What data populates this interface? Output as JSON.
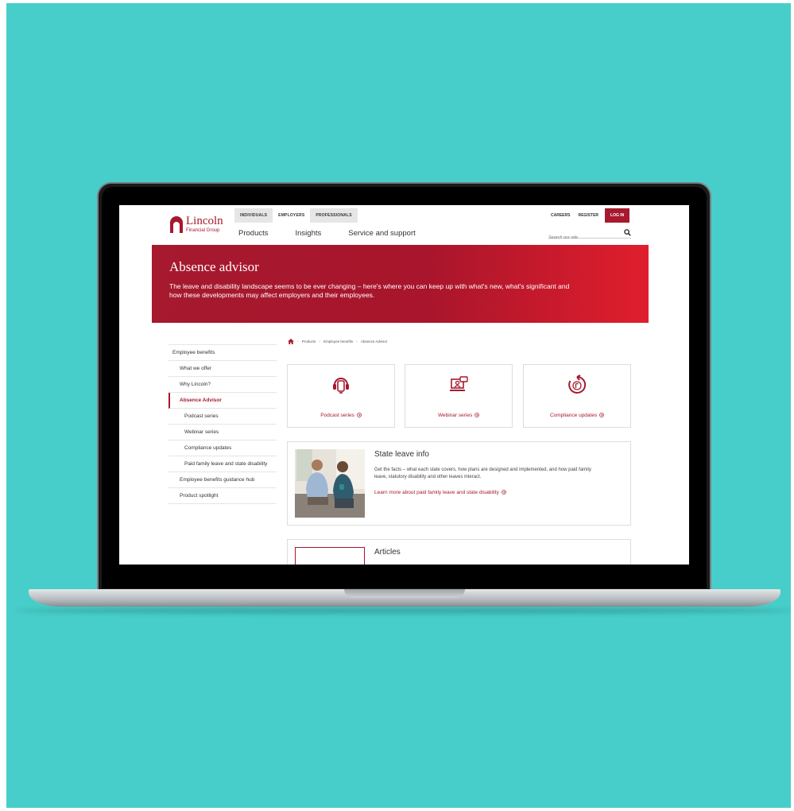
{
  "header": {
    "logo": {
      "word": "Lincoln",
      "sub": "Financial Group"
    },
    "audience_tabs": [
      "INDIVIDUALS",
      "EMPLOYERS",
      "PROFESSIONALS"
    ],
    "main_nav": {
      "products": "Products",
      "insights": "Insights",
      "service": "Service and support"
    },
    "utility": {
      "careers": "CAREERS",
      "register": "REGISTER",
      "login": "LOG IN"
    },
    "search": {
      "placeholder": "Search our site"
    }
  },
  "hero": {
    "title": "Absence advisor",
    "description": "The leave and disability landscape seems to be ever changing – here's where you can keep up with what's new, what's significant and how these developments may affect employers and their employees."
  },
  "breadcrumb": [
    "Products",
    "Employee benefits",
    "Absence Advisor"
  ],
  "sidebar": {
    "items": [
      "Employee benefits",
      "What we offer",
      "Why Lincoln?",
      "Absence Advisor",
      "Podcast series",
      "Webinar series",
      "Compliance updates",
      "Paid family leave and state disability",
      "Employee benefits guidance hub",
      "Product spotlight"
    ]
  },
  "cards": [
    {
      "label": "Podcast series",
      "icon": "podcast-icon"
    },
    {
      "label": "Webinar series",
      "icon": "webinar-icon"
    },
    {
      "label": "Compliance updates",
      "icon": "compliance-icon"
    }
  ],
  "state_leave": {
    "title": "State leave info",
    "description": "Get the facts – what each state covers, how plans are designed and implemented, and how paid family leave, statutory disability and other leaves interact.",
    "link": "Learn more about paid family leave and state disability"
  },
  "articles": {
    "title": "Articles"
  },
  "colors": {
    "brand": "#A6192E",
    "background": "#47CECA",
    "hero_end": "#E01E2D"
  }
}
